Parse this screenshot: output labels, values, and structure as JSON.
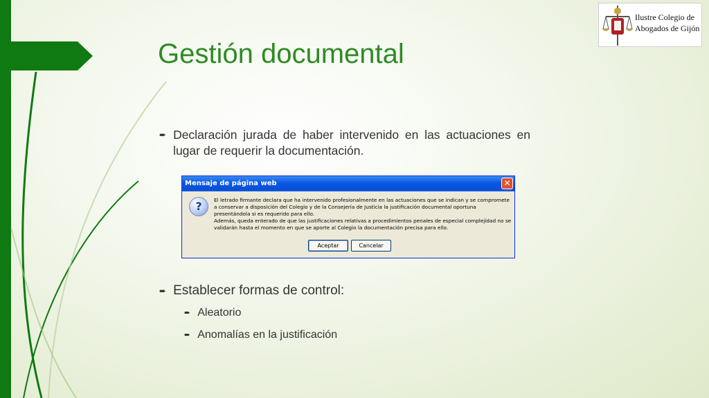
{
  "slide": {
    "title": "Gestión documental",
    "logo_text": "Ilustre Colegio de Abogados de Gijón",
    "bullets": {
      "b1": "Declaración jurada de haber intervenido en las actuaciones en lugar de requerir la documentación.",
      "b2": "Establecer formas de control:",
      "b3": "Aleatorio",
      "b4": "Anomalías en la justificación"
    }
  },
  "dialog": {
    "title": "Mensaje de página web",
    "message_line1": "El letrado firmante declara que ha intervenido profesionalmente en las actuaciones que se indican y se compromete a conservar a disposición del Colegio y de la Consejería de Justicia la justificación documental oportuna presentándola si es requerido para ello.",
    "message_line2": "Además, queda enterado de que las justificaciones relativas a procedimientos penales de especial complejidad no se validarán hasta el momento en que se aporte al Colegio la documentación precisa para ello.",
    "ok_label": "Aceptar",
    "cancel_label": "Cancelar",
    "icon": "question-icon"
  },
  "colors": {
    "accent": "#0f7a12",
    "title": "#2e8b24",
    "xp_title": "#0a4ed8"
  }
}
